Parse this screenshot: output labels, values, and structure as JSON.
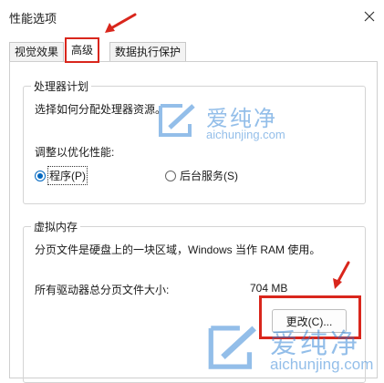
{
  "window": {
    "title": "性能选项",
    "close_icon": "close-icon"
  },
  "tabs": [
    {
      "label": "视觉效果",
      "active": false
    },
    {
      "label": "高级",
      "active": true
    },
    {
      "label": "数据执行保护",
      "active": false
    }
  ],
  "processor": {
    "group_title": "处理器计划",
    "description": "选择如何分配处理器资源。",
    "optimize_label": "调整以优化性能:",
    "options": [
      {
        "label": "程序(P)",
        "selected": true
      },
      {
        "label": "后台服务(S)",
        "selected": false
      }
    ]
  },
  "virtual_memory": {
    "group_title": "虚拟内存",
    "description": "分页文件是硬盘上的一块区域，Windows 当作 RAM 使用。",
    "total_label": "所有驱动器总分页文件大小:",
    "total_value": "704 MB",
    "change_button": "更改(C)..."
  },
  "watermarks": [
    {
      "brand": "爱纯净",
      "url": "aichunjing.com"
    },
    {
      "brand": "爱纯净",
      "url": "aichunjing.com"
    }
  ],
  "annotation_color": "#d9261c"
}
